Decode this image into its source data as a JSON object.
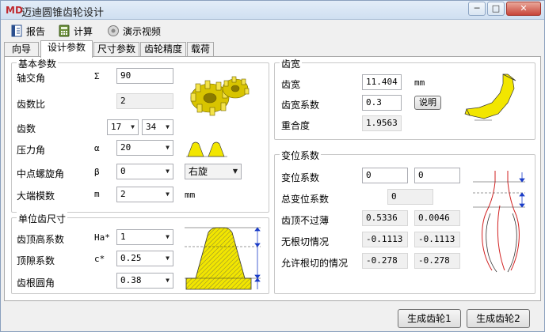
{
  "window": {
    "title": "迈迪圆锥齿轮设计",
    "app_icon": "MD",
    "caption_buttons": {
      "minimize": "─",
      "maximize": "□",
      "close": "✕"
    }
  },
  "toolbar": {
    "report": "报告",
    "calculate": "计算",
    "demo_video": "演示视频"
  },
  "tabs": [
    "向导",
    "设计参数",
    "尺寸参数",
    "齿轮精度",
    "载荷"
  ],
  "basic": {
    "title": "基本参数",
    "shaft_angle": {
      "label": "轴交角",
      "symbol": "Σ",
      "value": "90"
    },
    "tooth_ratio": {
      "label": "齿数比",
      "value": "2"
    },
    "teeth": {
      "label": "齿数",
      "z1": "17",
      "z2": "34"
    },
    "pressure_angle": {
      "label": "压力角",
      "symbol": "α",
      "value": "20"
    },
    "spiral_angle": {
      "label": "中点螺旋角",
      "symbol": "β",
      "value": "0",
      "hand": "右旋"
    },
    "module": {
      "label": "大端模数",
      "symbol": "m",
      "value": "2",
      "unit": "mm"
    }
  },
  "unit_tooth": {
    "title": "单位齿尺寸",
    "addendum": {
      "label": "齿顶高系数",
      "symbol": "Ha*",
      "value": "1"
    },
    "clearance": {
      "label": "顶隙系数",
      "symbol": "c*",
      "value": "0.25"
    },
    "root_fillet": {
      "label": "齿根圆角",
      "value": "0.38"
    }
  },
  "face_width": {
    "title": "齿宽",
    "width": {
      "label": "齿宽",
      "value": "11.404",
      "unit": "mm"
    },
    "coeff": {
      "label": "齿宽系数",
      "value": "0.3"
    },
    "explain_button": "说明",
    "contact_ratio": {
      "label": "重合度",
      "value": "1.9563"
    }
  },
  "shift": {
    "title": "变位系数",
    "coeff": {
      "label": "变位系数",
      "x1": "0",
      "x2": "0"
    },
    "total": {
      "label": "总变位系数",
      "value": "0"
    },
    "tip_thickness": {
      "label": "齿顶不过薄",
      "v1": "0.5336",
      "v2": "0.0046"
    },
    "no_undercut": {
      "label": "无根切情况",
      "v1": "-0.1113",
      "v2": "-0.1113"
    },
    "allowed_undercut": {
      "label": "允许根切的情况",
      "v1": "-0.278",
      "v2": "-0.278"
    }
  },
  "footer": {
    "gen_gear1": "生成齿轮1",
    "gen_gear2": "生成齿轮2"
  },
  "colors": {
    "accent_yellow": "#f2e600",
    "title_red": "#c0282d",
    "blue_dim": "#1a3cc8",
    "red_line": "#d22020"
  }
}
